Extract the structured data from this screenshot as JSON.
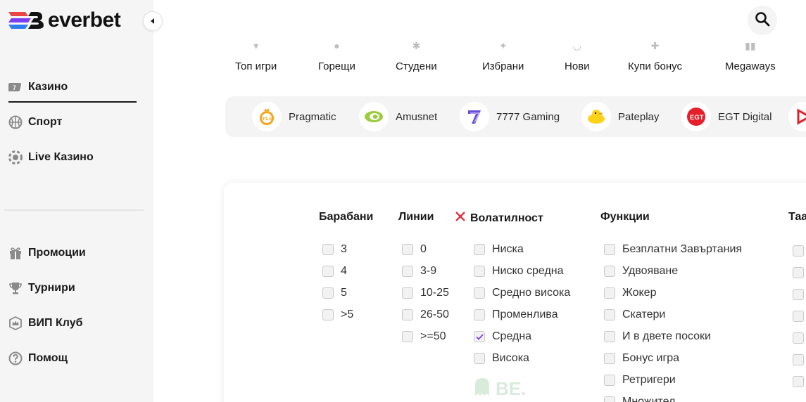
{
  "brand": {
    "name": "everbet",
    "colors": {
      "accent": "#1a1a1a",
      "logo_gradient": [
        "#e84545",
        "#7b3df0",
        "#2f7df5"
      ]
    }
  },
  "sidebar": {
    "items": [
      {
        "label": "Казино",
        "icon": "casino-icon",
        "active": true
      },
      {
        "label": "Спорт",
        "icon": "basketball-icon",
        "active": false
      },
      {
        "label": "Live Казино",
        "icon": "chip-icon",
        "active": false
      },
      {
        "label": "Промоции",
        "icon": "gift-icon",
        "active": false
      },
      {
        "label": "Турнири",
        "icon": "trophy-icon",
        "active": false
      },
      {
        "label": "ВИП Клуб",
        "icon": "crown-icon",
        "active": false
      },
      {
        "label": "Помощ",
        "icon": "help-icon",
        "active": false
      }
    ]
  },
  "categories": [
    "Топ игри",
    "Горещи",
    "Студени",
    "Избрани",
    "Нови",
    "Купи бонус",
    "Megaways"
  ],
  "providers": [
    "Pragmatic",
    "Amusnet",
    "7777 Gaming",
    "Pateplay",
    "EGT Digital"
  ],
  "filters": {
    "reels": {
      "title": "Барабани",
      "options": [
        "3",
        "4",
        "5",
        ">5"
      ]
    },
    "lines": {
      "title": "Линии",
      "options": [
        "0",
        "3-9",
        "10-25",
        "26-50",
        ">=50"
      ]
    },
    "volatility": {
      "title": "Волатилност",
      "options": [
        {
          "label": "Ниска",
          "checked": false
        },
        {
          "label": "Ниско средна",
          "checked": false
        },
        {
          "label": "Средно висока",
          "checked": false
        },
        {
          "label": "Променлива",
          "checked": false
        },
        {
          "label": "Средна",
          "checked": true
        },
        {
          "label": "Висока",
          "checked": false
        }
      ]
    },
    "features": {
      "title": "Функции",
      "options": [
        "Безплатни Завъртания",
        "Удвояване",
        "Жокер",
        "Скатери",
        "И в двете посоки",
        "Бонус игра",
        "Ретригери",
        "Множител"
      ]
    },
    "next_column_partial": {
      "title": "Таа"
    }
  },
  "watermark": "BE."
}
